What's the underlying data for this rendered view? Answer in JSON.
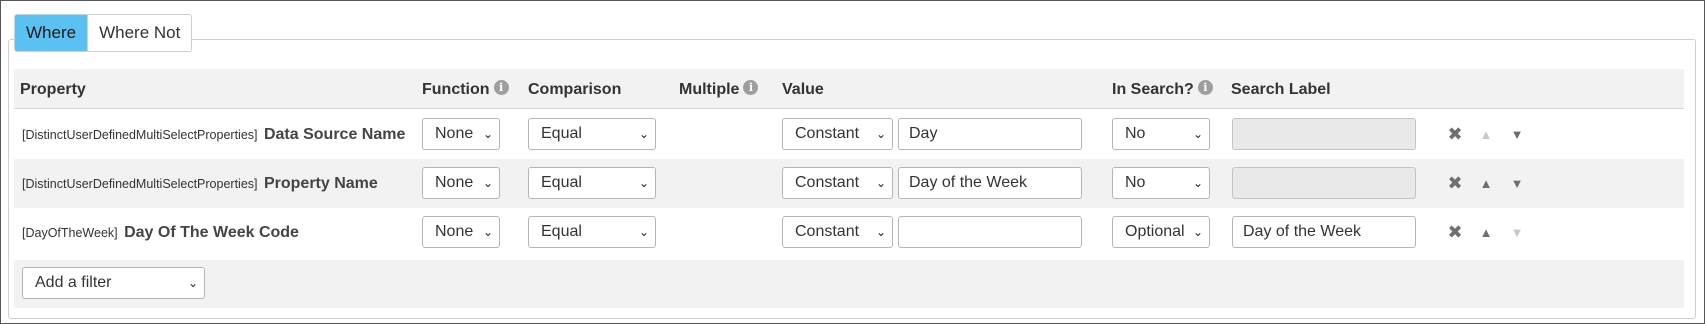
{
  "tabs": [
    {
      "label": "Where",
      "active": true
    },
    {
      "label": "Where Not",
      "active": false
    }
  ],
  "columns": {
    "property": "Property",
    "function": "Function",
    "comparison": "Comparison",
    "multiple": "Multiple",
    "value": "Value",
    "in_search": "In Search?",
    "search_label": "Search Label"
  },
  "rows": [
    {
      "prefix": "[DistinctUserDefinedMultiSelectProperties]",
      "name": "Data Source Name",
      "function": "None",
      "comparison": "Equal",
      "value_type": "Constant",
      "value": "Day",
      "in_search": "No",
      "search_label": "",
      "up_enabled": false,
      "down_enabled": true
    },
    {
      "prefix": "[DistinctUserDefinedMultiSelectProperties]",
      "name": "Property Name",
      "function": "None",
      "comparison": "Equal",
      "value_type": "Constant",
      "value": "Day of the Week",
      "in_search": "No",
      "search_label": "",
      "up_enabled": true,
      "down_enabled": true
    },
    {
      "prefix": "[DayOfTheWeek]",
      "name": "Day Of The Week Code",
      "function": "None",
      "comparison": "Equal",
      "value_type": "Constant",
      "value": "",
      "in_search": "Optional",
      "search_label": "Day of the Week",
      "up_enabled": true,
      "down_enabled": false
    }
  ],
  "add_filter": {
    "label": "Add a filter"
  },
  "icons": {
    "info": "info-icon",
    "remove": "close-icon",
    "move_up": "triangle-up-icon",
    "move_down": "triangle-down-icon",
    "dropdown": "chevron-down-icon"
  },
  "colors": {
    "active_tab": "#5bc0f2",
    "row_shade": "#f2f2f2",
    "disabled_input": "#e9e9e9"
  }
}
